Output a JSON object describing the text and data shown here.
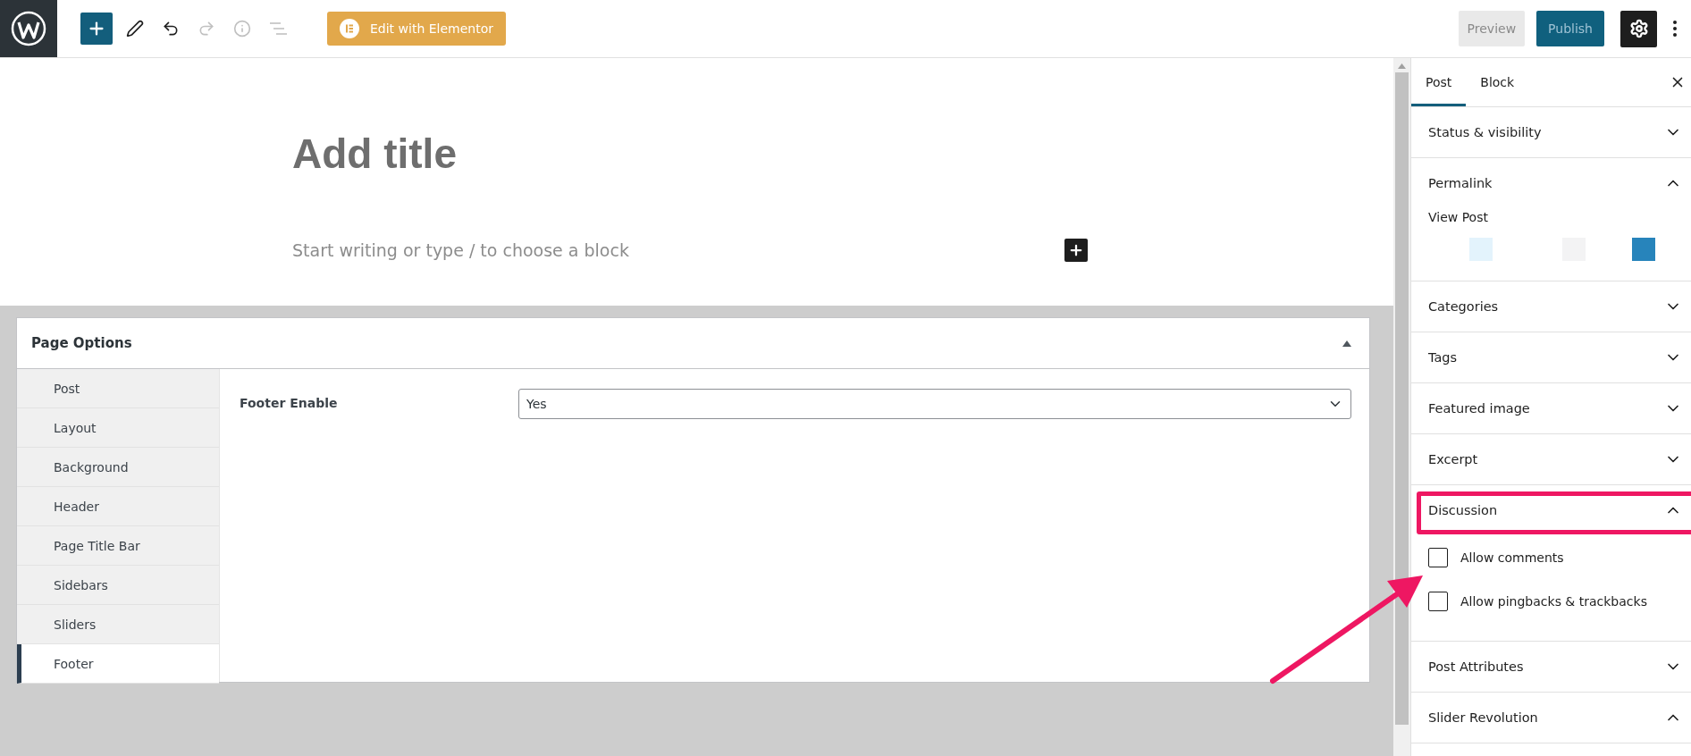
{
  "toolbar": {
    "tools": [
      {
        "kind": "edit",
        "disabled": false
      },
      {
        "kind": "undo",
        "disabled": false
      },
      {
        "kind": "redo",
        "disabled": true
      },
      {
        "kind": "details",
        "disabled": true
      },
      {
        "kind": "outline",
        "disabled": true
      }
    ],
    "elementor_button": "Edit with Elementor",
    "preview": "Preview",
    "publish": "Publish",
    "settings_open": true
  },
  "editor": {
    "title_placeholder": "Add title",
    "body_placeholder": "Start writing or type / to choose a block"
  },
  "page_options": {
    "title": "Page Options",
    "expanded": true,
    "nav": [
      {
        "label": "Post",
        "selected": false
      },
      {
        "label": "Layout",
        "selected": false
      },
      {
        "label": "Background",
        "selected": false
      },
      {
        "label": "Header",
        "selected": false
      },
      {
        "label": "Page Title Bar",
        "selected": false
      },
      {
        "label": "Sidebars",
        "selected": false
      },
      {
        "label": "Sliders",
        "selected": false
      },
      {
        "label": "Footer",
        "selected": true
      }
    ],
    "fields": [
      {
        "label": "Footer Enable",
        "value": "Yes"
      }
    ]
  },
  "sidebar": {
    "tabs": [
      {
        "label": "Post",
        "selected": true
      },
      {
        "label": "Block",
        "selected": false
      }
    ],
    "sections": [
      {
        "title": "Status & visibility",
        "expanded": false
      },
      {
        "title": "Permalink",
        "expanded": true,
        "link": "View Post",
        "swatches": [
          {
            "color": "#e3f3fc"
          },
          {
            "color": "#f3f3f4"
          },
          {
            "color": "#2784bb"
          }
        ]
      },
      {
        "title": "Categories",
        "expanded": false
      },
      {
        "title": "Tags",
        "expanded": false
      },
      {
        "title": "Featured image",
        "expanded": false
      },
      {
        "title": "Excerpt",
        "expanded": false
      },
      {
        "title": "Discussion",
        "expanded": true,
        "highlighted": true,
        "options": [
          {
            "label": "Allow comments",
            "checked": false
          },
          {
            "label": "Allow pingbacks & trackbacks",
            "checked": false
          }
        ]
      },
      {
        "title": "Post Attributes",
        "expanded": false
      },
      {
        "title": "Slider Revolution",
        "expanded": true
      }
    ]
  },
  "annotation": {
    "arrow": true
  }
}
